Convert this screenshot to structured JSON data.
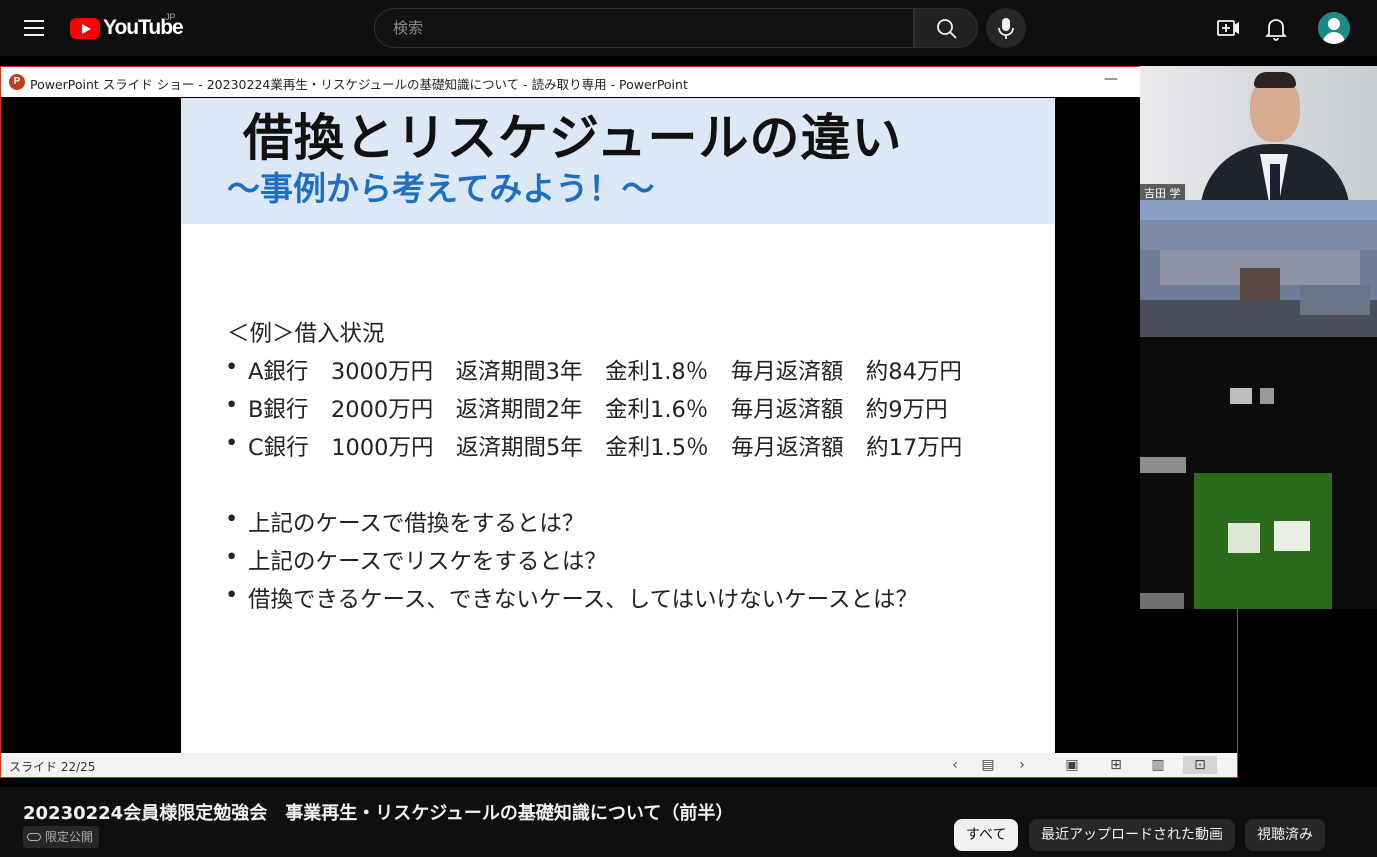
{
  "header": {
    "logo_text": "YouTube",
    "region": "JP",
    "search_placeholder": "検索"
  },
  "ppt": {
    "window_title": "PowerPoint スライド ショー  -  20230224業再生・リスケジュールの基礎知識について  -  読み取り専用 - PowerPoint",
    "icon_letter": "P",
    "minimize": "—",
    "status": "スライド 22/25",
    "slide": {
      "title": "借換とリスケジュールの違い",
      "subtitle": "～事例から考えてみよう！～",
      "example_heading": "＜例＞借入状況",
      "bank_rows": [
        "A銀行　3000万円　返済期間3年　金利1.8％　毎月返済額　約84万円",
        "B銀行　2000万円　返済期間2年　金利1.6％　毎月返済額　約9万円",
        "C銀行　1000万円　返済期間5年　金利1.5％　毎月返済額　約17万円"
      ],
      "questions": [
        "上記のケースで借換をするとは？",
        "上記のケースでリスケをするとは？",
        "借換できるケース、できないケース、してはいけないケースとは？"
      ],
      "bullet": "•"
    }
  },
  "participants": {
    "speaker_name": "吉田 学"
  },
  "video": {
    "title": "20230224会員様限定勉強会　事業再生・リスケジュールの基礎知識について（前半）",
    "privacy": "限定公開"
  },
  "chips": [
    "すべて",
    "最近アップロードされた動画",
    "視聴済み"
  ],
  "colors": {
    "accent": "#ff0000",
    "ppt_brand": "#c43e1c",
    "slide_subtitle": "#1f6fc0"
  }
}
